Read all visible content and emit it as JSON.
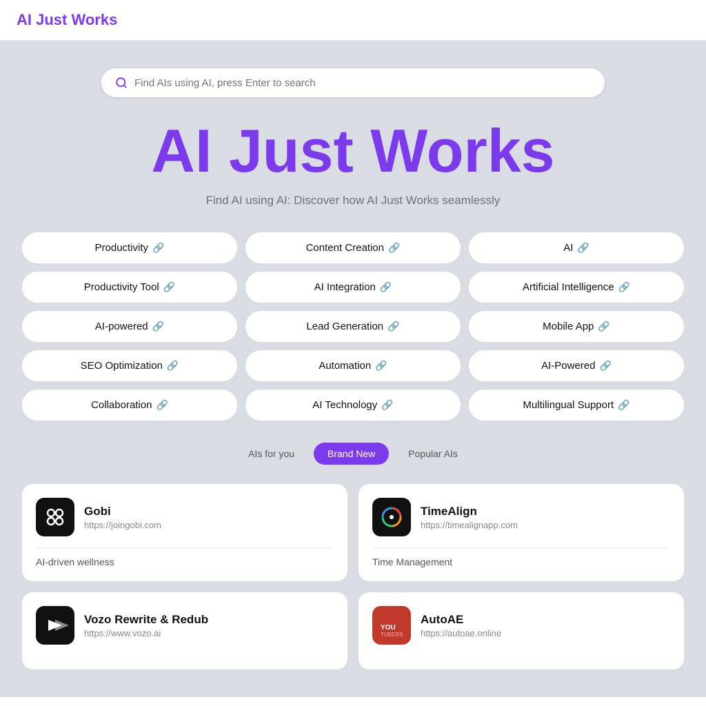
{
  "header": {
    "logo": "AI Just Works"
  },
  "search": {
    "placeholder": "Find AIs using AI, press Enter to search"
  },
  "hero": {
    "title": "AI Just Works",
    "subtitle": "Find AI using AI: Discover how AI Just Works seamlessly"
  },
  "categories": [
    {
      "label": "Productivity",
      "col": 0
    },
    {
      "label": "Content Creation",
      "col": 1
    },
    {
      "label": "AI",
      "col": 2
    },
    {
      "label": "Productivity Tool",
      "col": 0
    },
    {
      "label": "AI Integration",
      "col": 1
    },
    {
      "label": "Artificial Intelligence",
      "col": 2
    },
    {
      "label": "AI-powered",
      "col": 0
    },
    {
      "label": "Lead Generation",
      "col": 1
    },
    {
      "label": "Mobile App",
      "col": 2
    },
    {
      "label": "SEO Optimization",
      "col": 0
    },
    {
      "label": "Automation",
      "col": 1
    },
    {
      "label": "AI-Powered",
      "col": 2
    },
    {
      "label": "Collaboration",
      "col": 0
    },
    {
      "label": "AI Technology",
      "col": 1
    },
    {
      "label": "Multilingual Support",
      "col": 2
    }
  ],
  "tabs": [
    {
      "label": "AIs for you",
      "active": false
    },
    {
      "label": "Brand New",
      "active": true
    },
    {
      "label": "Popular AIs",
      "active": false
    }
  ],
  "cards": [
    {
      "id": "gobi",
      "name": "Gobi",
      "url": "https://joingobi.com",
      "description": "AI-driven wellness",
      "logo_type": "gobi"
    },
    {
      "id": "timealign",
      "name": "TimeAlign",
      "url": "https://timealignapp.com",
      "description": "Time Management",
      "logo_type": "timealign"
    },
    {
      "id": "vozo",
      "name": "Vozo Rewrite & Redub",
      "url": "https://www.vozo.ai",
      "description": "",
      "logo_type": "vozo"
    },
    {
      "id": "autoae",
      "name": "AutoAE",
      "url": "https://autoae.online",
      "description": "",
      "logo_type": "autoae"
    }
  ]
}
